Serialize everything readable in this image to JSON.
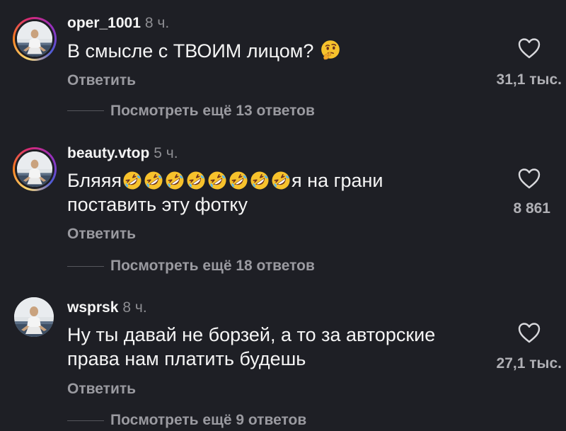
{
  "colors": {
    "background": "#1e1f25",
    "primary_text": "#f5f5f5",
    "secondary_text": "#9a9aa0",
    "story_ring": "#d62976"
  },
  "comments": [
    {
      "username": "oper_1001",
      "time": "8 ч.",
      "text_parts": [
        "В смысле с ТВОИМ лицом?"
      ],
      "emoji": "thinking-face",
      "reply_label": "Ответить",
      "like_icon": "heart-outline-icon",
      "likes": "31,1 тыс.",
      "more_replies": "Посмотреть ещё 13 ответов",
      "has_story_ring": true
    },
    {
      "username": "beauty.vtop",
      "time": "5 ч.",
      "text_before": "Бляяя",
      "emoji_count": 8,
      "emoji": "rolling-on-floor-laughing",
      "text_after": "я на грани",
      "text_line2": "поставить эту фотку",
      "reply_label": "Ответить",
      "like_icon": "heart-outline-icon",
      "likes": "8 861",
      "more_replies": "Посмотреть ещё 18 ответов",
      "has_story_ring": true
    },
    {
      "username": "wsprsk",
      "time": "8 ч.",
      "text_line1": "Ну ты давай не борзей, а то за авторские",
      "text_line2": "права нам платить будешь",
      "reply_label": "Ответить",
      "like_icon": "heart-outline-icon",
      "likes": "27,1 тыс.",
      "more_replies": "Посмотреть ещё 9 ответов",
      "has_story_ring": false
    }
  ]
}
